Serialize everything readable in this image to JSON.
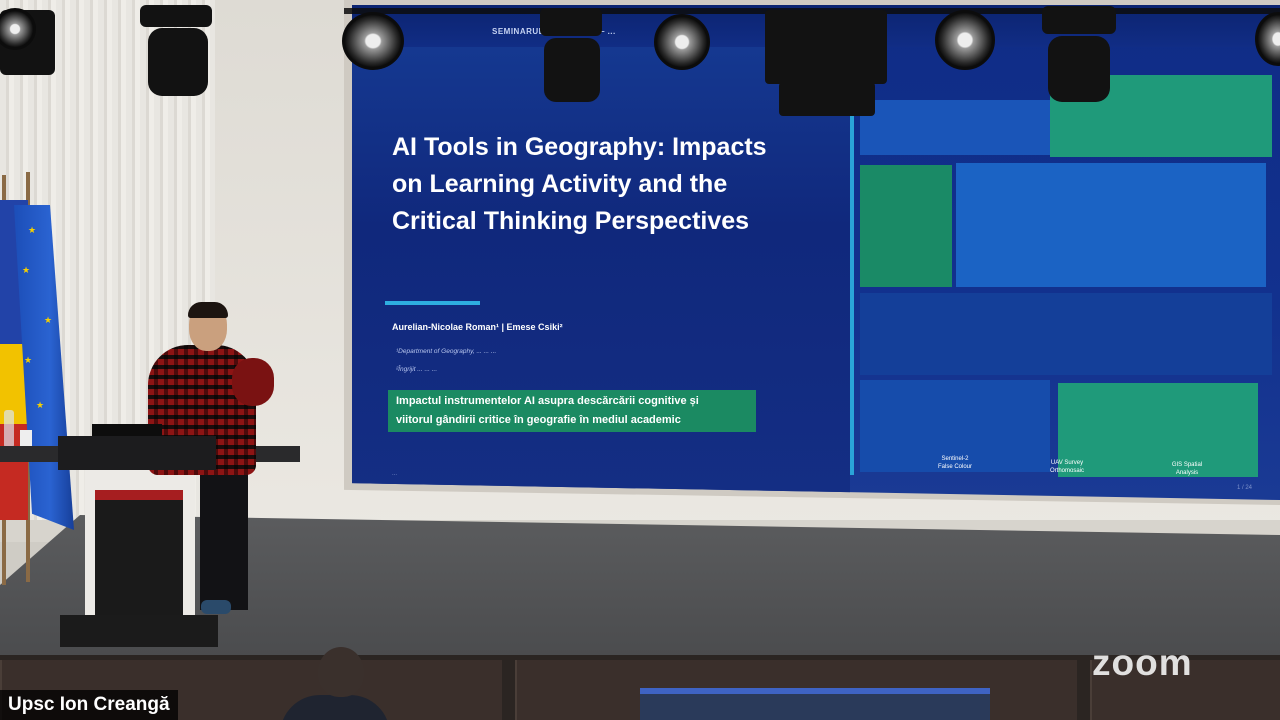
{
  "slide": {
    "header_text": "SEMINARUL Ș... ...tiința — ...",
    "title_lines": [
      "AI Tools in Geography: Impacts",
      "on Learning Activity and the",
      "Critical Thinking Perspectives"
    ],
    "authors": "Aurelian-Nicolae Roman¹  |  Emese Csiki²",
    "affiliation_1": "¹Department of Geography, ... ... ...",
    "affiliation_2": "²Îngrijit ... ... ...",
    "highlight_lines": [
      "Impactul instrumentelor AI asupra descărcării cognitive și",
      "viitorul gândirii critice în geografie în mediul academic"
    ],
    "footer_url": "...",
    "captions": [
      "Sentinel-2",
      "UAV Survey",
      "GIS Spatial"
    ],
    "captions_sub": [
      "False Colour",
      "Orthomosaic",
      "Analysis"
    ],
    "page_number": "1 / 24",
    "colors": {
      "background": "#12318e",
      "accent": "#2aa4d8",
      "highlight": "#1b8a62",
      "tile_green": "#1f9a7a",
      "tile_blue": "#1b63c4"
    }
  },
  "overlay": {
    "participant_name": "Upsc Ion Creangă",
    "brand_logo": "zoom"
  }
}
